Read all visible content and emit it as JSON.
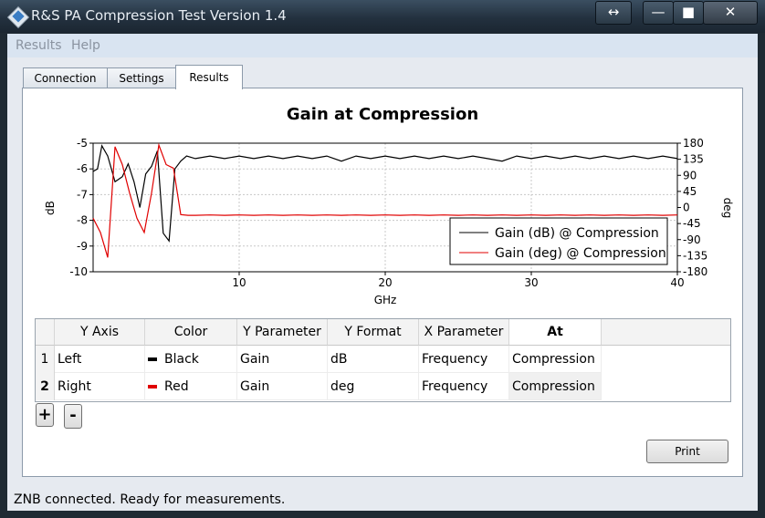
{
  "window": {
    "title": "R&S PA Compression Test Version 1.4",
    "controls": {
      "move": "↔",
      "minimize": "—",
      "maximize": "■",
      "close": "✕"
    }
  },
  "menu": {
    "items": [
      "Results",
      "Help"
    ]
  },
  "tabs": [
    "Connection",
    "Settings",
    "Results"
  ],
  "active_tab": "Results",
  "chart_data": {
    "type": "line",
    "title": "Gain at Compression",
    "xlabel": "GHz",
    "ylabel_left": "dB",
    "ylabel_right": "deg",
    "xlim": [
      0,
      40
    ],
    "ylim_left": [
      -10,
      -5
    ],
    "ylim_right": [
      -180,
      180
    ],
    "x_ticks": [
      "10",
      "20",
      "30",
      "40"
    ],
    "y_ticks_left": [
      "-5",
      "-6",
      "-7",
      "-8",
      "-9",
      "-10"
    ],
    "y_ticks_right": [
      "180",
      "135",
      "90",
      "45",
      "0",
      "-45",
      "-90",
      "-135",
      "-180"
    ],
    "grid": true,
    "legend_position": "right",
    "series": [
      {
        "name": "Gain (dB) @ Compression",
        "axis": "left",
        "color": "#000000",
        "x": [
          0,
          0.3,
          0.6,
          1.0,
          1.5,
          2.0,
          2.4,
          2.8,
          3.2,
          3.6,
          4.0,
          4.4,
          4.8,
          5.2,
          5.6,
          6.0,
          6.4,
          7,
          8,
          9,
          10,
          11,
          12,
          13,
          14,
          15,
          16,
          17,
          18,
          19,
          20,
          21,
          22,
          23,
          24,
          25,
          26,
          27,
          28,
          29,
          30,
          31,
          32,
          33,
          34,
          35,
          36,
          37,
          38,
          39,
          40
        ],
        "values": [
          -6.1,
          -6.0,
          -5.1,
          -5.5,
          -6.5,
          -6.3,
          -5.8,
          -6.5,
          -7.5,
          -6.2,
          -5.9,
          -5.3,
          -8.5,
          -8.8,
          -6.0,
          -5.7,
          -5.5,
          -5.6,
          -5.5,
          -5.6,
          -5.5,
          -5.6,
          -5.5,
          -5.6,
          -5.5,
          -5.6,
          -5.5,
          -5.7,
          -5.5,
          -5.6,
          -5.5,
          -5.6,
          -5.5,
          -5.6,
          -5.5,
          -5.6,
          -5.5,
          -5.6,
          -5.7,
          -5.5,
          -5.6,
          -5.5,
          -5.6,
          -5.5,
          -5.6,
          -5.5,
          -5.6,
          -5.5,
          -5.6,
          -5.5,
          -5.6
        ]
      },
      {
        "name": "Gain (deg) @ Compression",
        "axis": "right",
        "color": "#e00000",
        "x": [
          0,
          0.5,
          1.0,
          1.5,
          2.0,
          2.5,
          3.0,
          3.5,
          4.0,
          4.5,
          5.0,
          5.5,
          6.0,
          6.5,
          7,
          8,
          9,
          10,
          11,
          12,
          13,
          14,
          15,
          16,
          17,
          18,
          19,
          20,
          21,
          22,
          23,
          24,
          25,
          26,
          27,
          28,
          29,
          30,
          31,
          32,
          33,
          34,
          35,
          36,
          37,
          38,
          39,
          40
        ],
        "values": [
          -30,
          -70,
          -140,
          170,
          120,
          40,
          -30,
          -70,
          40,
          175,
          120,
          110,
          -20,
          -22,
          -22,
          -21,
          -22,
          -21,
          -22,
          -21,
          -22,
          -21,
          -22,
          -21,
          -22,
          -21,
          -22,
          -21,
          -22,
          -21,
          -22,
          -21,
          -22,
          -21,
          -22,
          -21,
          -22,
          -21,
          -22,
          -21,
          -22,
          -21,
          -22,
          -21,
          -22,
          -21,
          -22,
          -21
        ]
      }
    ]
  },
  "table": {
    "columns": [
      "Y Axis",
      "Color",
      "Y Parameter",
      "Y Format",
      "X Parameter",
      "At"
    ],
    "rows": [
      {
        "num": "1",
        "y_axis": "Left",
        "color_name": "Black",
        "color_hex": "#000000",
        "y_param": "Gain",
        "y_format": "dB",
        "x_param": "Frequency",
        "at": "Compression"
      },
      {
        "num": "2",
        "y_axis": "Right",
        "color_name": "Red",
        "color_hex": "#e00000",
        "y_param": "Gain",
        "y_format": "deg",
        "x_param": "Frequency",
        "at": "Compression"
      }
    ]
  },
  "buttons": {
    "add": "+",
    "remove": "-",
    "print": "Print"
  },
  "status": "ZNB connected. Ready for measurements."
}
